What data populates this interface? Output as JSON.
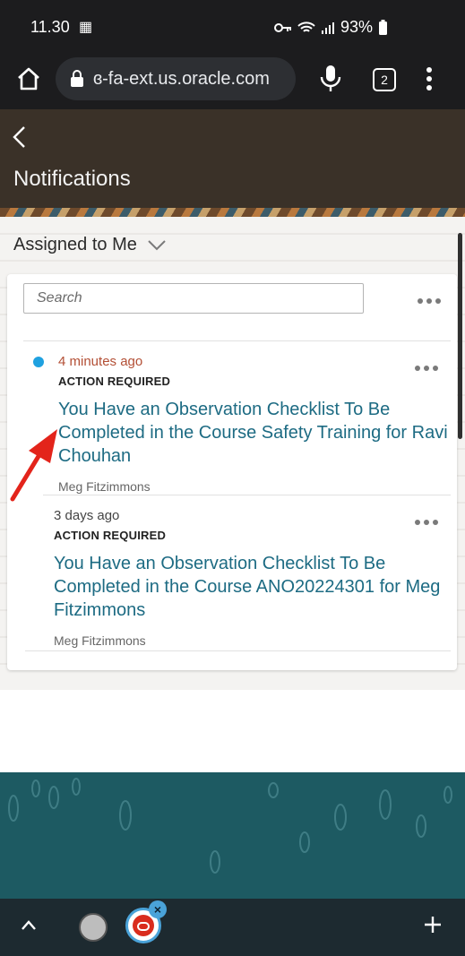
{
  "status_bar": {
    "time": "11.30",
    "battery": "93%"
  },
  "browser": {
    "url": "ɞ-fa-ext.us.oracle.com",
    "tab_count": "2"
  },
  "header": {
    "title": "Notifications"
  },
  "filter": {
    "label": "Assigned to Me"
  },
  "search": {
    "placeholder": "Search"
  },
  "notifications": [
    {
      "time": "4 minutes ago",
      "status": "ACTION REQUIRED",
      "title": "You Have an Observation Checklist To Be Completed in the Course Safety Training for Ravi Chouhan",
      "from": "Meg Fitzimmons",
      "unread": true
    },
    {
      "time": "3 days ago",
      "status": "ACTION REQUIRED",
      "title": "You Have an Observation Checklist To Be Completed in the Course ANO20224301 for Meg Fitzimmons",
      "from": "Meg Fitzimmons",
      "unread": false
    }
  ],
  "colors": {
    "link": "#1d6b83",
    "time_new": "#b34f35",
    "unread": "#1fa1e0",
    "header_bg": "#3a3128",
    "teal_bg": "#1d5a62",
    "arrow": "#e3241b"
  },
  "icons": [
    "home-icon",
    "lock-icon",
    "mic-icon",
    "menu-icon",
    "back-icon",
    "chevron-down-icon",
    "more-icon",
    "up-icon",
    "plus-icon"
  ]
}
